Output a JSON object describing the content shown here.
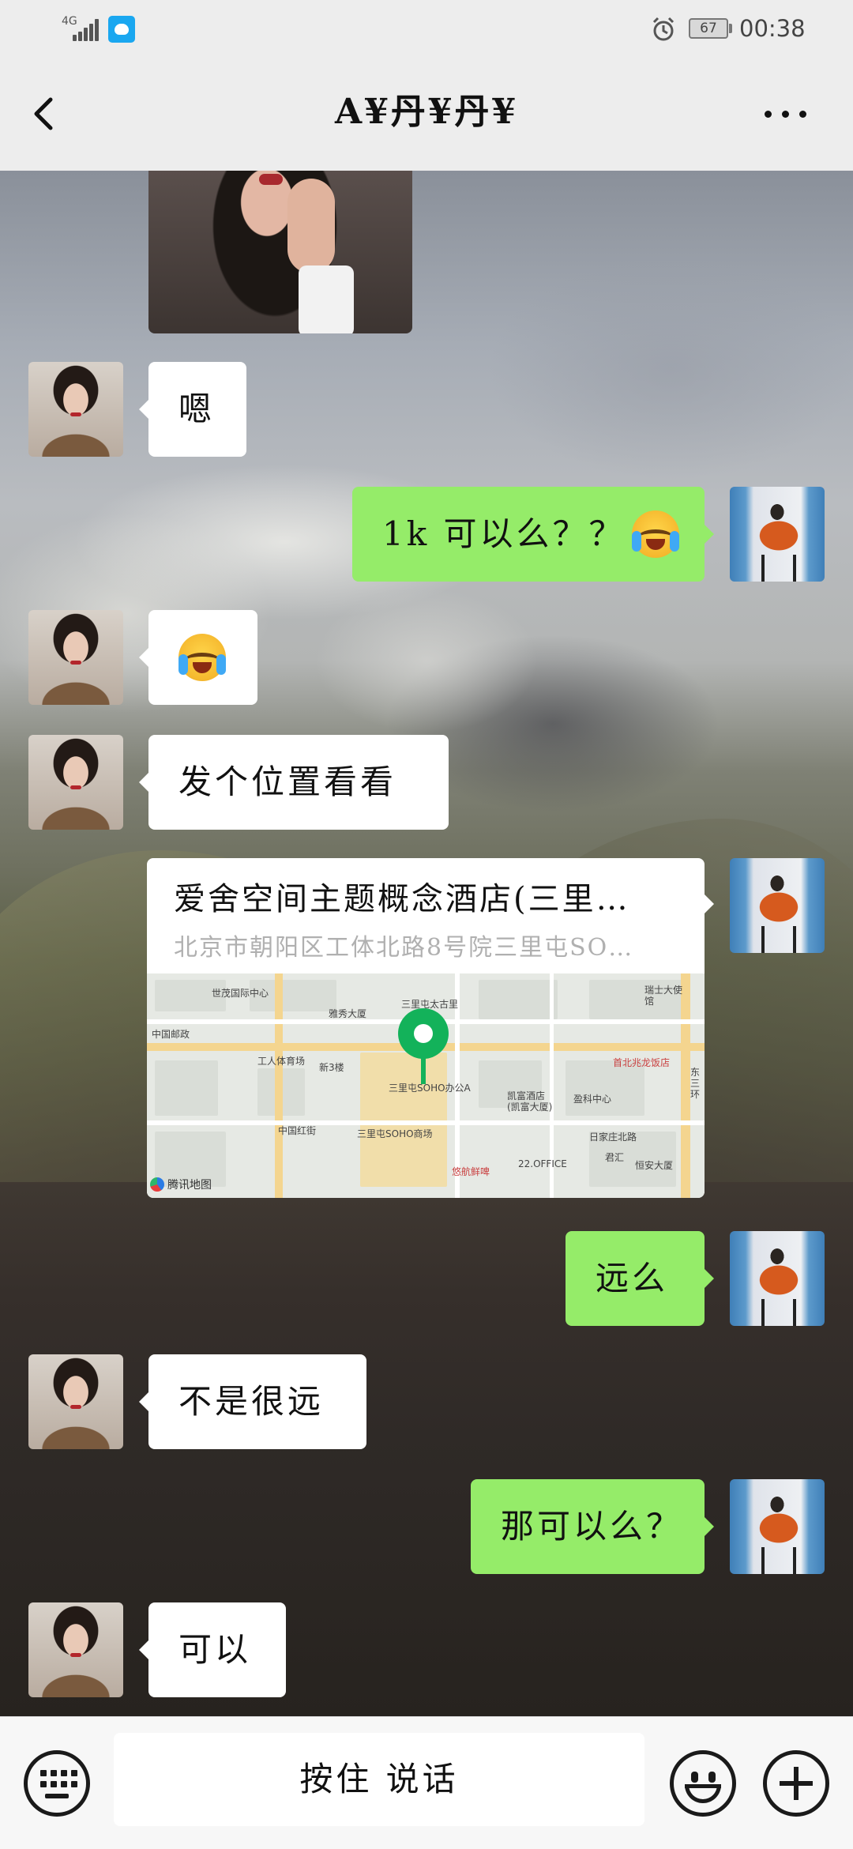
{
  "status_bar": {
    "network": "4G",
    "battery": "67",
    "time": "00:38",
    "icons": [
      "signal-icon",
      "app-notification-icon",
      "alarm-icon",
      "battery-icon"
    ]
  },
  "header": {
    "title": "A¥丹¥丹¥",
    "back_icon": "chevron-left-icon",
    "more_icon": "more-dots-icon"
  },
  "messages": [
    {
      "from": "contact",
      "type": "image"
    },
    {
      "from": "contact",
      "type": "text",
      "text": "嗯"
    },
    {
      "from": "self",
      "type": "text",
      "text": "1k 可以么？？",
      "emoji": "loudly-crying-face"
    },
    {
      "from": "contact",
      "type": "emoji",
      "emoji": "loudly-crying-face"
    },
    {
      "from": "contact",
      "type": "text",
      "text": "发个位置看看"
    },
    {
      "from": "self",
      "type": "location",
      "title": "爱舍空间主题概念酒店(三里…",
      "address": "北京市朝阳区工体北路8号院三里屯SO…",
      "map": {
        "brand": "腾讯地图",
        "labels": [
          "世茂国际中心",
          "雅秀大厦",
          "三里屯太古里",
          "三里屯SOHO办公A",
          "中国邮政",
          "工人体育场",
          "新3楼",
          "中国红街",
          "三里屯SOHO商场",
          "凯富酒店(凯富大厦)",
          "盈科中心",
          "首北兆龙饭店",
          "日家庄北路",
          "君汇",
          "22.OFFICE",
          "悠航鲜啤",
          "恒安大厦",
          "瑞士大使馆",
          "东三环"
        ]
      }
    },
    {
      "from": "self",
      "type": "text",
      "text": "远么"
    },
    {
      "from": "contact",
      "type": "text",
      "text": "不是很远"
    },
    {
      "from": "self",
      "type": "text",
      "text": "那可以么？"
    },
    {
      "from": "contact",
      "type": "text",
      "text": "可以"
    }
  ],
  "input_bar": {
    "hold_to_talk_label": "按住 说话",
    "keyboard_icon": "keyboard-icon",
    "emoji_icon": "smiley-icon",
    "plus_icon": "plus-icon"
  },
  "colors": {
    "outgoing_bubble": "#95ec69",
    "incoming_bubble": "#ffffff",
    "header_bg": "#ededed",
    "map_pin": "#13b25a"
  }
}
